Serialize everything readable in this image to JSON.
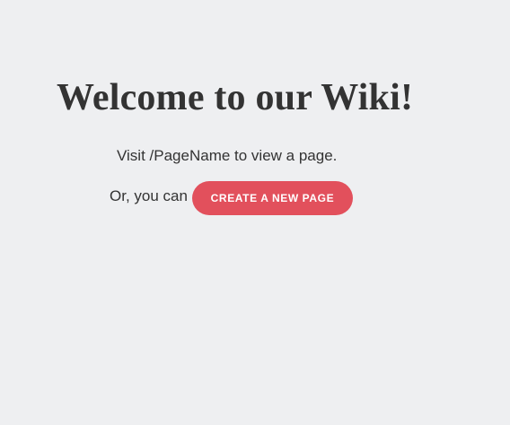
{
  "page": {
    "title": "Welcome to our Wiki!",
    "visit_text": "Visit /PageName to view a page.",
    "or_text": "Or, you can",
    "create_button_label": "CREATE A NEW PAGE"
  },
  "colors": {
    "background": "#eeeff1",
    "text": "#333333",
    "button": "#e2505c",
    "button_text": "#ffffff"
  }
}
